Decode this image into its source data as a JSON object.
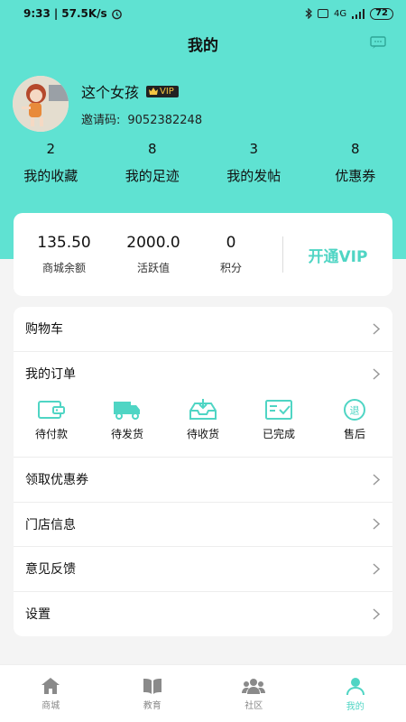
{
  "status_bar": {
    "time": "9:33",
    "speed": "57.5K/s",
    "network": "4G",
    "battery": "72"
  },
  "header": {
    "title": "我的"
  },
  "profile": {
    "name": "这个女孩",
    "vip_badge": "VIP",
    "invite_label": "邀请码:",
    "invite_code": "9052382248"
  },
  "stats": [
    {
      "value": "2",
      "label": "我的收藏"
    },
    {
      "value": "8",
      "label": "我的足迹"
    },
    {
      "value": "3",
      "label": "我的发帖"
    },
    {
      "value": "8",
      "label": "优惠券"
    }
  ],
  "wallet": {
    "items": [
      {
        "value": "135.50",
        "label": "商城余额"
      },
      {
        "value": "2000.0",
        "label": "活跃值"
      },
      {
        "value": "0",
        "label": "积分"
      }
    ],
    "open_vip": "开通VIP"
  },
  "menu": {
    "cart": "购物车",
    "orders": "我的订单",
    "order_status": [
      "待付款",
      "待发货",
      "待收货",
      "已完成",
      "售后"
    ],
    "return_glyph": "退",
    "coupons": "领取优惠券",
    "store_info": "门店信息",
    "feedback": "意见反馈",
    "settings": "设置"
  },
  "tabs": [
    "商城",
    "教育",
    "社区",
    "我的"
  ],
  "colors": {
    "accent": "#5fe2d2",
    "accent_text": "#4fd5c4"
  }
}
